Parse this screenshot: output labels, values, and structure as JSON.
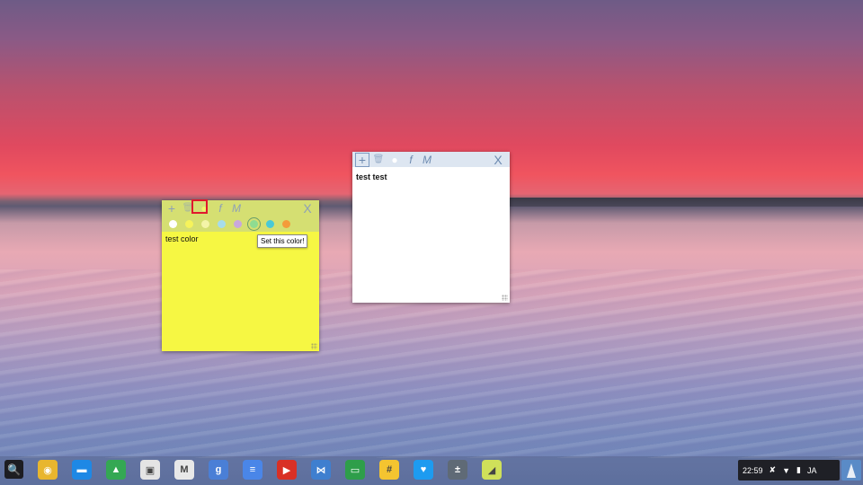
{
  "desktop": {
    "wallpaper": "sunset-lake"
  },
  "note_yellow": {
    "toolbar": {
      "add": "+",
      "delete": "🗑",
      "color": "●",
      "font": "f",
      "menu": "M",
      "close": "X"
    },
    "color_swatches": [
      "#ffffff",
      "#f6f35b",
      "#f4f4a8",
      "#a6dcec",
      "#c9a8dc",
      "#8fdc91",
      "#4ac9d6",
      "#f49b3a"
    ],
    "text": "test color",
    "tooltip": "Set this color!",
    "bg_color": "#f6f743",
    "toolbar_color": "#d5df72"
  },
  "note_white": {
    "toolbar": {
      "add": "+",
      "delete": "🗑",
      "color": "●",
      "font": "f",
      "menu": "M",
      "close": "X"
    },
    "text": "test test",
    "bg_color": "#ffffff",
    "toolbar_color": "#dde6f1"
  },
  "shelf": {
    "apps": [
      "chrome-icon",
      "files-icon",
      "drive-icon",
      "chrome-store-icon",
      "gmail-icon",
      "google-search-icon",
      "docs-icon",
      "youtube-icon",
      "keep-like-icon",
      "chromebook-icon",
      "hash-icon",
      "twitter-icon",
      "calculator-icon",
      "sticky-notes-icon"
    ],
    "tray": {
      "time": "22:59",
      "ime": "JA"
    }
  }
}
